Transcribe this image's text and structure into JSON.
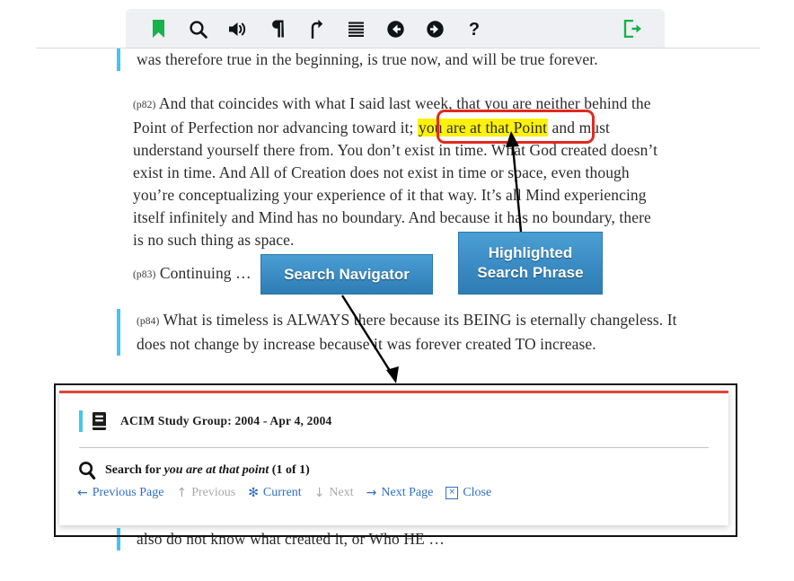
{
  "toolbar": {
    "buttons": [
      {
        "name": "bookmark-icon",
        "label": "Bookmark",
        "glyph": "bookmark",
        "color": "#17b24a"
      },
      {
        "name": "search-icon",
        "label": "Search",
        "glyph": "search",
        "color": "#111416"
      },
      {
        "name": "audio-icon",
        "label": "Audio",
        "glyph": "speaker",
        "color": "#111416"
      },
      {
        "name": "paragraph-icon",
        "label": "Paragraph",
        "glyph": "pilcrow",
        "color": "#111416"
      },
      {
        "name": "go-to-top-icon",
        "label": "Go to top",
        "glyph": "arrow-up-turn",
        "color": "#111416"
      },
      {
        "name": "contents-icon",
        "label": "Contents",
        "glyph": "lines",
        "color": "#111416"
      },
      {
        "name": "previous-icon",
        "label": "Previous",
        "glyph": "arrow-left-circle",
        "color": "#111416"
      },
      {
        "name": "next-icon",
        "label": "Next",
        "glyph": "arrow-right-circle",
        "color": "#111416"
      },
      {
        "name": "help-icon",
        "label": "Help",
        "glyph": "question",
        "color": "#111416"
      }
    ],
    "exit": {
      "name": "exit-icon",
      "label": "Exit",
      "glyph": "exit",
      "color": "#17b24a"
    }
  },
  "document": {
    "paragraph_top": {
      "text": "was therefore true in the beginning, is true now, and will be true forever."
    },
    "paragraph_82": {
      "number": "(p82)",
      "before_highlight": " And that coincides with what I said last week, that you are neither behind the Point of Perfection nor advancing toward it; ",
      "highlight": "you are at that Point",
      "after_highlight": " and must understand yourself there from. You don’t exist in time. What God created doesn’t exist in time. And All of Creation does not exist in time or space, even though you’re conceptualizing your experience of it that way. It’s all Mind experiencing itself infinitely and Mind has no boundary. And because it has no boundary, there is no such thing as space."
    },
    "paragraph_83": {
      "number": "(p83)",
      "text": " Continuing …"
    },
    "paragraph_84": {
      "number": "(p84)",
      "text": " What is timeless is ALWAYS there because its BEING is eternally changeless. It does not change by increase because it was forever created TO increase."
    },
    "paragraph_bottom": {
      "text": "also do not know what created it, or Who HE …"
    }
  },
  "annotations": {
    "search_navigator_label": "Search Navigator",
    "highlighted_phrase_label_line1": "Highlighted",
    "highlighted_phrase_label_line2": "Search Phrase",
    "callout_color": "#3b8cc4",
    "highlight_color": "#fbf10a",
    "ring_color": "#e02a20"
  },
  "search_navigator": {
    "title": "ACIM Study Group: 2004 - Apr 4, 2004",
    "book_icon": "book-icon",
    "search_icon": "search-icon",
    "search_prefix": "Search for ",
    "search_phrase": "you are at that point",
    "search_count": " (1 of 1)",
    "links": [
      {
        "name": "previous-page-link",
        "label": "Previous Page",
        "glyph": "←",
        "disabled": false
      },
      {
        "name": "previous-link",
        "label": "Previous",
        "glyph": "↑",
        "disabled": true
      },
      {
        "name": "current-link",
        "label": "Current",
        "glyph": "✻",
        "disabled": false
      },
      {
        "name": "next-link",
        "label": "Next",
        "glyph": "↓",
        "disabled": true
      },
      {
        "name": "next-page-link",
        "label": "Next Page",
        "glyph": "→",
        "disabled": false
      },
      {
        "name": "close-link",
        "label": "Close",
        "glyph": "×",
        "disabled": false
      }
    ],
    "accent_color": "#46c4f0",
    "top_border_color": "#e0443c",
    "link_color": "#2f6fc4"
  }
}
